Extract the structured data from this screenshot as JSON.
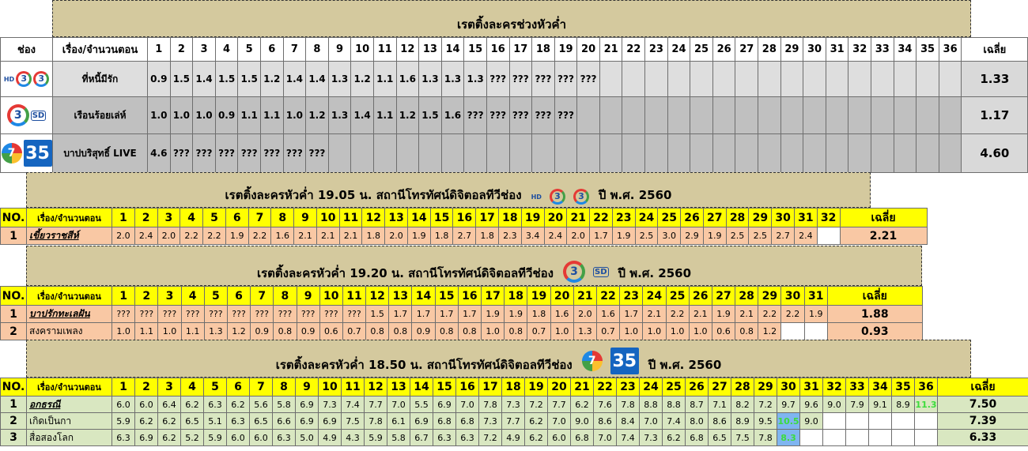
{
  "section1": {
    "title": "เรตติ้งละครช่วงหัวค่ำ",
    "header": {
      "channel": "ช่อง",
      "title": "เรื่อง/จำนวนตอน",
      "avg": "เฉลี่ย",
      "eps": [
        "1",
        "2",
        "3",
        "4",
        "5",
        "6",
        "7",
        "8",
        "9",
        "10",
        "11",
        "12",
        "13",
        "14",
        "15",
        "16",
        "17",
        "18",
        "19",
        "20",
        "21",
        "22",
        "23",
        "24",
        "25",
        "26",
        "27",
        "28",
        "29",
        "30",
        "31",
        "32",
        "33",
        "34",
        "35",
        "36"
      ]
    },
    "rows": [
      {
        "logo": "ch3hd",
        "logo_text": "3",
        "logo_tag": "HD",
        "title": "ที่หนี้มีรัก",
        "avg": "1.33",
        "values": [
          "0.9",
          "1.5",
          "1.4",
          "1.5",
          "1.5",
          "1.2",
          "1.4",
          "1.4",
          "1.3",
          "1.2",
          "1.1",
          "1.6",
          "1.3",
          "1.3",
          "1.3",
          "???",
          "???",
          "???",
          "???",
          "???"
        ]
      },
      {
        "logo": "ch3sd",
        "logo_text": "3",
        "logo_tag": "SD",
        "title": "เรือนร้อยเล่ห์",
        "avg": "1.17",
        "values": [
          "1.0",
          "1.0",
          "1.0",
          "0.9",
          "1.1",
          "1.1",
          "1.0",
          "1.2",
          "1.3",
          "1.4",
          "1.1",
          "1.2",
          "1.5",
          "1.6",
          "???",
          "???",
          "???",
          "???",
          "???"
        ]
      },
      {
        "logo": "ch7hd",
        "logo_text": "7",
        "logo_tag": "35",
        "title": "บาปบริสุทธิ์ LIVE",
        "avg": "4.60",
        "values": [
          "4.6",
          "???",
          "???",
          "???",
          "???",
          "???",
          "???",
          "???"
        ]
      }
    ]
  },
  "section2": {
    "title_pre": "เรตติ้งละครหัวค่ำ 19.05 น. สถานีโทรทัศน์ดิจิตอลทีวีช่อง",
    "title_post": "ปี พ.ศ. 2560",
    "logo_text": "3",
    "logo_tag": "HD",
    "header": {
      "no": "NO.",
      "title": "เรื่อง/จำนวนตอน",
      "avg": "เฉลี่ย",
      "eps": [
        "1",
        "2",
        "3",
        "4",
        "5",
        "6",
        "7",
        "8",
        "9",
        "10",
        "11",
        "12",
        "13",
        "14",
        "15",
        "16",
        "17",
        "18",
        "19",
        "20",
        "21",
        "22",
        "23",
        "24",
        "25",
        "26",
        "27",
        "28",
        "29",
        "30",
        "31",
        "32"
      ]
    },
    "rows": [
      {
        "no": "1",
        "title": "เขี้ยวราชสีห์",
        "avg": "2.21",
        "values": [
          "2.0",
          "2.4",
          "2.0",
          "2.2",
          "2.2",
          "1.9",
          "2.2",
          "1.6",
          "2.1",
          "2.1",
          "2.1",
          "1.8",
          "2.0",
          "1.9",
          "1.8",
          "2.7",
          "1.8",
          "2.3",
          "3.4",
          "2.4",
          "2.0",
          "1.7",
          "1.9",
          "2.5",
          "3.0",
          "2.9",
          "1.9",
          "2.5",
          "2.5",
          "2.7",
          "2.4"
        ]
      }
    ]
  },
  "section3": {
    "title_pre": "เรตติ้งละครหัวค่ำ 19.20 น. สถานีโทรทัศน์ดิจิตอลทีวีช่อง",
    "title_post": "ปี พ.ศ. 2560",
    "logo_text": "3",
    "logo_tag": "SD",
    "header": {
      "no": "NO.",
      "title": "เรื่อง/จำนวนตอน",
      "avg": "เฉลี่ย",
      "eps": [
        "1",
        "2",
        "3",
        "4",
        "5",
        "6",
        "7",
        "8",
        "9",
        "10",
        "11",
        "12",
        "13",
        "14",
        "15",
        "16",
        "17",
        "18",
        "19",
        "20",
        "21",
        "22",
        "23",
        "24",
        "25",
        "26",
        "27",
        "28",
        "29",
        "30",
        "31"
      ]
    },
    "rows": [
      {
        "no": "1",
        "title": "บาปรักทะเลฝัน",
        "avg": "1.88",
        "values": [
          "???",
          "???",
          "???",
          "???",
          "???",
          "???",
          "???",
          "???",
          "???",
          "???",
          "???",
          "1.5",
          "1.7",
          "1.7",
          "1.7",
          "1.7",
          "1.9",
          "1.9",
          "1.8",
          "1.6",
          "2.0",
          "1.6",
          "1.7",
          "2.1",
          "2.2",
          "2.1",
          "1.9",
          "2.1",
          "2.2",
          "2.2",
          "1.9"
        ]
      },
      {
        "no": "2",
        "title": "สงครามเพลง",
        "avg": "0.93",
        "values": [
          "1.0",
          "1.1",
          "1.0",
          "1.1",
          "1.3",
          "1.2",
          "0.9",
          "0.8",
          "0.9",
          "0.6",
          "0.7",
          "0.8",
          "0.8",
          "0.9",
          "0.8",
          "0.8",
          "1.0",
          "0.8",
          "0.7",
          "1.0",
          "1.3",
          "0.7",
          "1.0",
          "1.0",
          "1.0",
          "1.0",
          "0.6",
          "0.8",
          "1.2"
        ]
      }
    ]
  },
  "section4": {
    "title_pre": "เรตติ้งละครหัวค่ำ 18.50 น. สถานีโทรทัศน์ดิจิตอลทีวีช่อง",
    "title_post": "ปี พ.ศ. 2560",
    "logo_text": "7",
    "logo_tag": "35",
    "header": {
      "no": "NO.",
      "title": "เรื่อง/จำนวนตอน",
      "avg": "เฉลี่ย",
      "eps": [
        "1",
        "2",
        "3",
        "4",
        "5",
        "6",
        "7",
        "8",
        "9",
        "10",
        "11",
        "12",
        "13",
        "14",
        "15",
        "16",
        "17",
        "18",
        "19",
        "20",
        "21",
        "22",
        "23",
        "24",
        "25",
        "26",
        "27",
        "28",
        "29",
        "30",
        "31",
        "32",
        "33",
        "34",
        "35",
        "36"
      ]
    },
    "rows": [
      {
        "no": "1",
        "title": "อกธรณี",
        "avg": "7.50",
        "values": [
          "6.0",
          "6.0",
          "6.4",
          "6.2",
          "6.3",
          "6.2",
          "5.6",
          "5.8",
          "6.9",
          "7.3",
          "7.4",
          "7.7",
          "7.0",
          "5.5",
          "6.9",
          "7.0",
          "7.8",
          "7.3",
          "7.2",
          "7.7",
          "6.2",
          "7.6",
          "7.8",
          "8.8",
          "8.8",
          "8.7",
          "7.1",
          "8.2",
          "7.2",
          "9.7",
          "9.6",
          "9.0",
          "7.9",
          "9.1",
          "8.9",
          "11.3"
        ]
      },
      {
        "no": "2",
        "title": "เกิดเป็นกา",
        "avg": "7.39",
        "values": [
          "5.9",
          "6.2",
          "6.2",
          "6.5",
          "5.1",
          "6.3",
          "6.5",
          "6.6",
          "6.9",
          "6.9",
          "7.5",
          "7.8",
          "6.1",
          "6.9",
          "6.8",
          "6.8",
          "7.3",
          "7.7",
          "6.2",
          "7.0",
          "9.0",
          "8.6",
          "8.4",
          "7.0",
          "7.4",
          "8.0",
          "8.6",
          "8.9",
          "9.5",
          "10.5",
          "9.0"
        ]
      },
      {
        "no": "3",
        "title": "สื่อสองโลก",
        "avg": "6.33",
        "values": [
          "6.3",
          "6.9",
          "6.2",
          "5.2",
          "5.9",
          "6.0",
          "6.0",
          "6.3",
          "5.0",
          "4.9",
          "4.3",
          "5.9",
          "5.8",
          "6.7",
          "6.3",
          "6.3",
          "7.2",
          "4.9",
          "6.2",
          "6.0",
          "6.8",
          "7.0",
          "7.4",
          "7.3",
          "6.2",
          "6.8",
          "6.5",
          "7.5",
          "7.8",
          "8.3"
        ]
      }
    ]
  }
}
